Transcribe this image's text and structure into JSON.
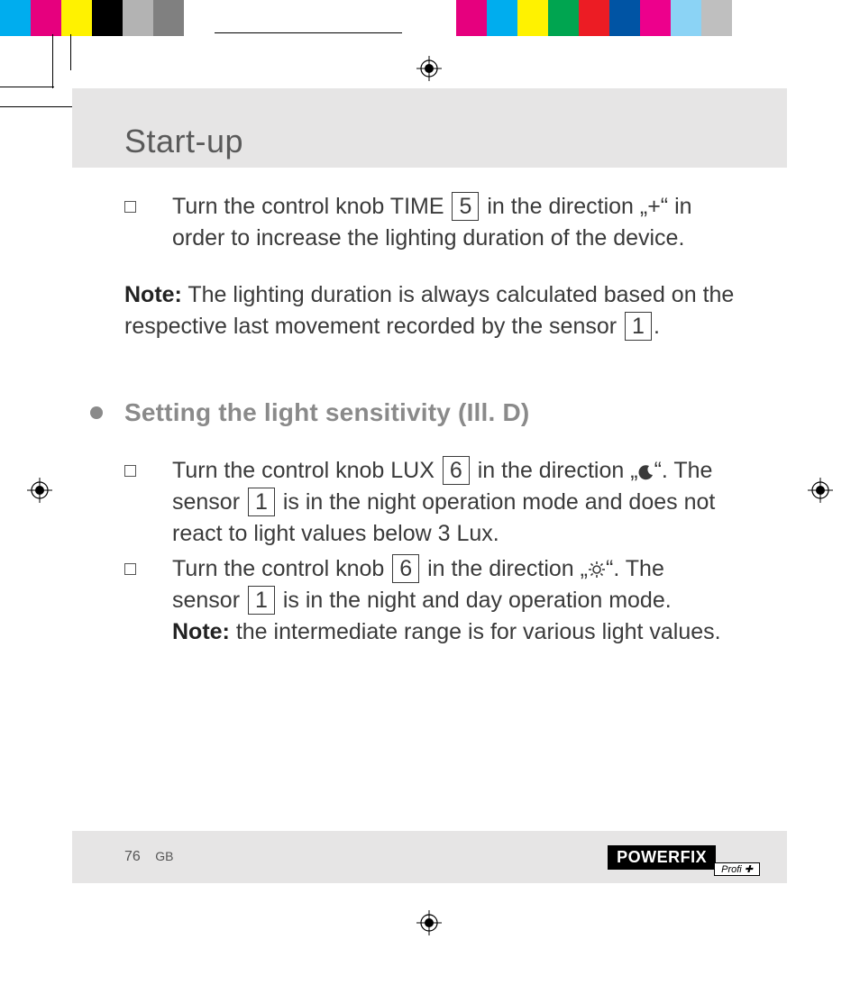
{
  "header": {
    "title": "Start-up"
  },
  "items": {
    "time": {
      "text_pre": "Turn the control knob TIME ",
      "ref": "5",
      "text_post": " in the direction „+“ in order to increase the lighting duration of the device."
    }
  },
  "note1": {
    "label": "Note:",
    "text_pre": " The lighting duration is always calculated based on the respective last movement recorded by the sensor ",
    "ref": "1",
    "text_post": "."
  },
  "section2": {
    "heading": "Setting the light sensitivity (Ill. D)"
  },
  "lux_a": {
    "pre": "Turn the control knob LUX ",
    "ref_a": "6",
    "mid1": " in the direction „",
    "moon_icon": "moon-icon",
    "mid2": "“. The sensor ",
    "ref_b": "1",
    "post": " is in the night operation mode and does not react to light values below 3 Lux."
  },
  "lux_b": {
    "pre": "Turn the control knob ",
    "ref_a": "6",
    "mid1": " in the direction „",
    "sun_icon": "sun-icon",
    "mid2": "“. The sensor ",
    "ref_b": "1",
    "post": " is in the night and day operation mode.",
    "note_label": "Note:",
    "note_text": " the intermediate range is for various light values."
  },
  "footer": {
    "page": "76",
    "region": "GB",
    "brand": "POWERFIX",
    "brand_sub": "Profi ✚"
  },
  "colorbar": [
    "#00adee",
    "#e6007e",
    "#fff200",
    "#000000",
    "#b3b3b3",
    "#808080",
    "#ffffff"
  ],
  "colorbar_right": [
    "#e6007e",
    "#00adee",
    "#fff200",
    "#00a550",
    "#ec1c24",
    "#0054a4",
    "#ed008c",
    "#8bd3f5",
    "#bfbfbf"
  ]
}
